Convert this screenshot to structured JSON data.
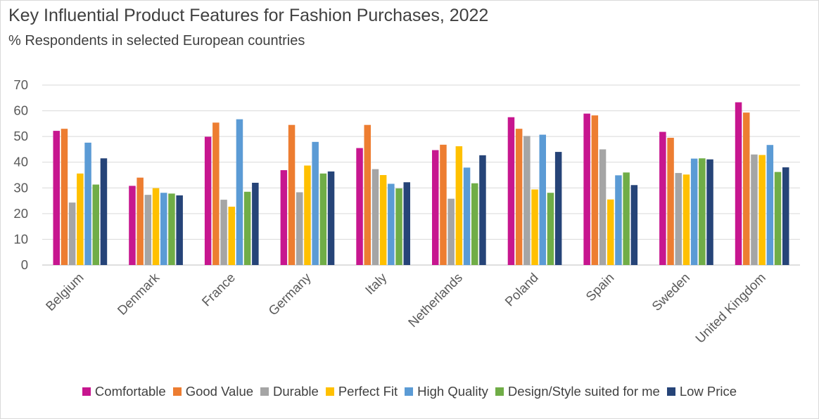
{
  "chart_data": {
    "type": "bar",
    "title": "Key Influential Product Features for Fashion Purchases, 2022",
    "subtitle": "% Respondents in selected European countries",
    "categories": [
      "Belgium",
      "Denmark",
      "France",
      "Germany",
      "Italy",
      "Netherlands",
      "Poland",
      "Spain",
      "Sweden",
      "United Kingdom"
    ],
    "ylim": [
      0,
      70
    ],
    "yticks": [
      0,
      10,
      20,
      30,
      40,
      50,
      60,
      70
    ],
    "grid": true,
    "legend_position": "bottom",
    "series": [
      {
        "name": "Comfortable",
        "color": "#c7168f",
        "values": [
          52.2,
          30.8,
          49.9,
          36.9,
          45.5,
          44.7,
          57.5,
          58.9,
          51.8,
          63.3
        ]
      },
      {
        "name": "Good Value",
        "color": "#ed7d31",
        "values": [
          53.0,
          34.0,
          55.4,
          54.5,
          54.5,
          46.8,
          53.0,
          58.2,
          49.5,
          59.3
        ]
      },
      {
        "name": "Durable",
        "color": "#a5a5a5",
        "values": [
          24.3,
          27.3,
          25.4,
          28.3,
          37.3,
          25.8,
          50.2,
          45.0,
          35.8,
          43.0
        ]
      },
      {
        "name": "Perfect Fit",
        "color": "#ffc000",
        "values": [
          35.6,
          29.9,
          22.7,
          38.7,
          35.0,
          46.2,
          29.4,
          25.5,
          35.2,
          42.8
        ]
      },
      {
        "name": "High Quality",
        "color": "#5b9bd5",
        "values": [
          47.6,
          28.1,
          56.7,
          47.9,
          31.6,
          37.9,
          50.7,
          34.9,
          41.4,
          46.7
        ]
      },
      {
        "name": "Design/Style suited for me",
        "color": "#70ad47",
        "values": [
          31.3,
          27.8,
          28.5,
          35.6,
          29.8,
          31.8,
          28.1,
          36.0,
          41.5,
          36.2
        ]
      },
      {
        "name": "Low Price",
        "color": "#264478",
        "values": [
          41.5,
          27.1,
          32.0,
          36.4,
          32.2,
          42.7,
          44.0,
          31.1,
          41.1,
          38.0
        ]
      }
    ]
  }
}
